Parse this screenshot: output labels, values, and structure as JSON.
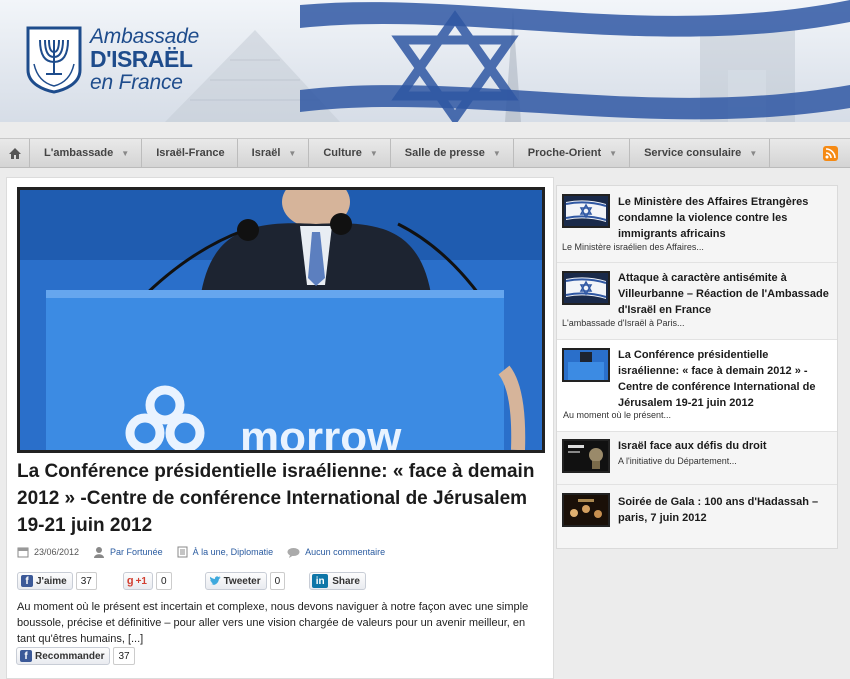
{
  "header": {
    "logo_line1": "Ambassade",
    "logo_line2": "D'ISRAËL",
    "logo_line3": "en France"
  },
  "nav": {
    "home_icon": "home-icon",
    "items": [
      {
        "label": "L'ambassade",
        "has_dropdown": true
      },
      {
        "label": "Israël-France",
        "has_dropdown": false
      },
      {
        "label": "Israël",
        "has_dropdown": true
      },
      {
        "label": "Culture",
        "has_dropdown": true
      },
      {
        "label": "Salle de presse",
        "has_dropdown": true
      },
      {
        "label": "Proche-Orient",
        "has_dropdown": true
      },
      {
        "label": "Service consulaire",
        "has_dropdown": true
      }
    ],
    "rss_icon": "rss-icon"
  },
  "article": {
    "title": "La Conférence présidentielle israélienne: « face à demain 2012 » -Centre de conférence International de Jérusalem 19-21 juin 2012",
    "date": "23/06/2012",
    "author": "Par Fortunée",
    "categories": "À la une, Diplomatie",
    "comments": "Aucun commentaire",
    "excerpt": "  Au moment où le présent  est incertain et complexe, nous devons naviguer à notre façon avec une simple boussole, précise et définitive – pour aller vers une vision chargée de valeurs pour un avenir meilleur, en tant qu'êtres humains, [...]",
    "podium_text": "morrow"
  },
  "social": {
    "like_label": "J'aime",
    "like_count": "37",
    "gplus_label": "+1",
    "gplus_count": "0",
    "tweet_label": "Tweeter",
    "tweet_count": "0",
    "linkedin_label": "Share",
    "recommend_label": "Recommander",
    "recommend_count": "37"
  },
  "sidebar": {
    "items": [
      {
        "title": "Le Ministère des Affaires Etrangères condamne la violence contre les immigrants africains",
        "excerpt": "Le Ministère israélien des Affaires..."
      },
      {
        "title": "Attaque à caractère antisémite à Villeurbanne – Réaction de l'Ambassade d'Israël en France",
        "excerpt": "L'ambassade d'Israël à Paris..."
      },
      {
        "title": "La Conférence présidentielle israélienne: « face à demain 2012 » -Centre de conférence International de Jérusalem 19-21 juin 2012",
        "excerpt": " Au moment où le présent..."
      },
      {
        "title": "Israël face aux défis du droit",
        "excerpt": "A l'initiative du Département..."
      },
      {
        "title": "Soirée de Gala : 100 ans d'Hadassah – paris, 7 juin 2012",
        "excerpt": ""
      }
    ]
  },
  "colors": {
    "brand_blue": "#1e4c8c",
    "link_blue": "#2a5ba0",
    "rss_orange": "#f58a14",
    "facebook_blue": "#3b5998"
  }
}
